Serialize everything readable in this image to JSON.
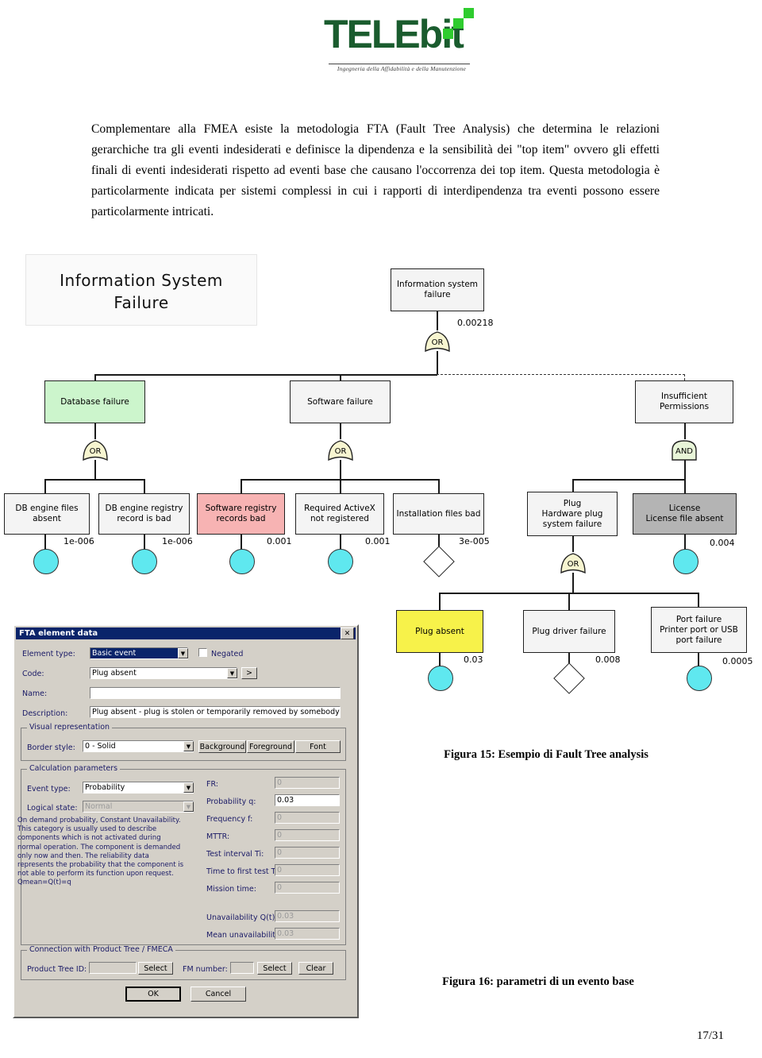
{
  "logo": {
    "wordmark": "TELEbit",
    "tagline": "Ingegneria della Affidabilità e della Manutenzione"
  },
  "paragraph": {
    "text": "Complementare alla FMEA esiste la metodologia FTA (Fault Tree Analysis) che determina le relazioni gerarchiche tra gli eventi indesiderati e definisce la dipendenza e la sensibilità dei \"top item\" ovvero gli effetti finali di eventi indesiderati rispetto ad eventi base che causano l'occorrenza dei top item. Questa metodologia è particolarmente indicata per sistemi complessi in cui i rapporti di interdipendenza tra eventi possono essere particolarmente intricati."
  },
  "fault_tree": {
    "panel_title": "Information System\nFailure",
    "panel_title_line1": "Information System",
    "panel_title_line2": "Failure",
    "top": {
      "label": "Information system\nfailure",
      "probability": "0.00218",
      "gate": "OR"
    },
    "level2": [
      {
        "label": "Database failure",
        "gate": "OR",
        "color": "green"
      },
      {
        "label": "Software failure",
        "gate": "OR",
        "color": "white"
      },
      {
        "label": "Insufficient\nPermissions",
        "gate": "AND",
        "color": "white"
      }
    ],
    "level3": [
      {
        "label": "DB engine files\nabsent",
        "probability": "1e-006",
        "symbol": "circle",
        "color": "white"
      },
      {
        "label": "DB engine registry\nrecord is bad",
        "probability": "1e-006",
        "symbol": "circle",
        "color": "white"
      },
      {
        "label": "Software registry\nrecords bad",
        "probability": "0.001",
        "symbol": "circle",
        "color": "pink"
      },
      {
        "label": "Required ActiveX\nnot registered",
        "probability": "0.001",
        "symbol": "circle",
        "color": "white"
      },
      {
        "label": "Installation files bad",
        "probability": "3e-005",
        "symbol": "diamond",
        "color": "white"
      },
      {
        "label": "Plug\nHardware plug\nsystem failure",
        "gate": "OR",
        "symbol": "gate",
        "color": "white"
      },
      {
        "label": "License\nLicense file absent",
        "probability": "0.004",
        "symbol": "circle",
        "color": "gray"
      }
    ],
    "level4": [
      {
        "label": "Plug absent",
        "probability": "0.03",
        "symbol": "circle",
        "color": "yellow"
      },
      {
        "label": "Plug driver failure",
        "probability": "0.008",
        "symbol": "diamond",
        "color": "white"
      },
      {
        "label": "Port failure\nPrinter port or USB\nport failure",
        "probability": "0.0005",
        "symbol": "circle",
        "color": "white"
      }
    ]
  },
  "dialog": {
    "title": "FTA element data",
    "close": "✕",
    "element_type_label": "Element type:",
    "element_type_value": "Basic event",
    "negated_label": "Negated",
    "code_label": "Code:",
    "code_value": "Plug absent",
    "code_more_button": ">",
    "name_label": "Name:",
    "name_value": "",
    "description_label": "Description:",
    "description_value": "Plug absent - plug is stolen or temporarily removed by somebody",
    "visual_group": "Visual representation",
    "border_style_label": "Border style:",
    "border_style_value": "0 - Solid",
    "background_button": "Background",
    "foreground_button": "Foreground",
    "font_button": "Font",
    "calc_group": "Calculation parameters",
    "event_type_label": "Event type:",
    "event_type_value": "Probability",
    "logical_state_label": "Logical state:",
    "logical_state_value": "Normal",
    "help_text": "On demand probability, Constant Unavailability.\nThis category is usually used to describe components which is not activated during normal operation. The component is demanded only now and then. The reliability data represents the probability that the component is not able to perform its function upon request.\nQmean=Q(t)=q",
    "fields": [
      {
        "label": "FR:",
        "value": "0",
        "disabled": true
      },
      {
        "label": "Probability q:",
        "value": "0.03",
        "disabled": false
      },
      {
        "label": "Frequency f:",
        "value": "0",
        "disabled": true
      },
      {
        "label": "MTTR:",
        "value": "0",
        "disabled": true
      },
      {
        "label": "Test interval Ti:",
        "value": "0",
        "disabled": true
      },
      {
        "label": "Time to first test Tf:",
        "value": "0",
        "disabled": true
      },
      {
        "label": "Mission time:",
        "value": "0",
        "disabled": true
      }
    ],
    "result_fields": [
      {
        "label": "Unavailability Q(t):",
        "value": "0.03"
      },
      {
        "label": "Mean unavailability Q:",
        "value": "0.03"
      }
    ],
    "connection_group": "Connection with Product Tree / FMECA",
    "product_tree_label": "Product Tree ID:",
    "product_tree_value": "",
    "product_tree_select": "Select",
    "fm_number_label": "FM number:",
    "fm_number_value": "",
    "fm_number_select": "Select",
    "clear_button": "Clear",
    "ok_button": "OK",
    "cancel_button": "Cancel"
  },
  "captions": {
    "figure15": "Figura 15: Esempio di Fault Tree analysis",
    "figure16": "Figura 16: parametri di un evento base"
  },
  "footer": {
    "page": "17/31"
  }
}
